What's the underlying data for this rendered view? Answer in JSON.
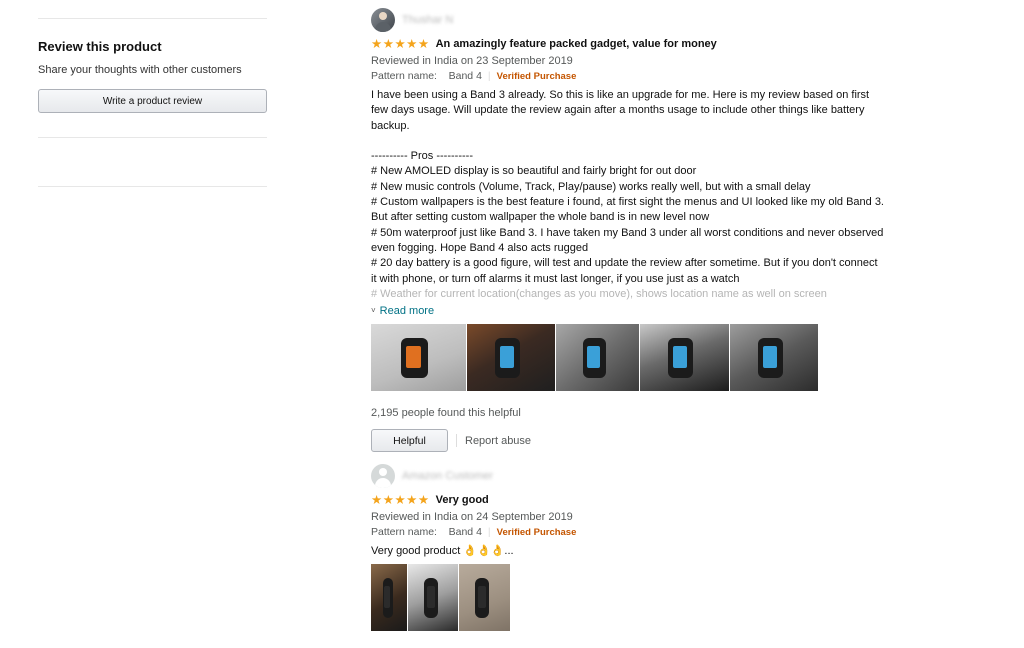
{
  "sidebar": {
    "heading": "Review this product",
    "subtitle": "Share your thoughts with other customers",
    "write_review_label": "Write a product review"
  },
  "reviews": [
    {
      "reviewer_name": "Thushar N",
      "rating": 5,
      "star_glyph": "★",
      "title": "An amazingly feature packed gadget, value for money",
      "date_line": "Reviewed in India on 23 September 2019",
      "pattern_label": "Pattern name:",
      "pattern_value": "Band 4",
      "verified": "Verified Purchase",
      "body_lines": [
        "I have been using a     Band 3 already. So this is like an upgrade for me. Here is my review based on first",
        "few days usage. Will update the review again after a months usage to include other things like battery",
        "backup.",
        "",
        "---------- Pros ----------",
        "# New AMOLED display is so beautiful and fairly bright for out door",
        "# New music controls (Volume, Track, Play/pause) works really well, but with a small delay",
        "# Custom wallpapers is the best feature i found, at first sight the menus and UI looked like my old Band 3.",
        "But after setting custom wallpaper the whole band is in new level now",
        "# 50m waterproof just like Band 3. I have taken my Band 3 under all worst conditions and never observed",
        "even fogging. Hope Band 4 also acts rugged",
        "# 20 day battery is a good figure, will test and update the review after sometime. But if you don't connect",
        "it with phone, or turn off alarms it must last longer, if you use just as a watch",
        "# Weather for current location(changes as you move), shows location name as well on screen"
      ],
      "read_more": "Read more",
      "images": [
        {
          "name": "review-image-band-charger",
          "bg": "linear-gradient(160deg,#d9d9d9 0%,#bdbdbd 60%,#9e9e9e 100%)"
        },
        {
          "name": "review-image-band-on-wrist",
          "bg": "linear-gradient(150deg,#7a4a2a 0%,#3b2a22 45%,#1f1f1f 100%)"
        },
        {
          "name": "review-image-band-in-hand",
          "bg": "linear-gradient(140deg,#a7a7a7 0%,#6d6d6d 50%,#3a3a3a 100%)"
        },
        {
          "name": "review-image-band-keyboard",
          "bg": "linear-gradient(160deg,#c8c8c8 0%,#6a6a6a 45%,#1c1c1c 100%)"
        },
        {
          "name": "review-image-band-colorful",
          "bg": "linear-gradient(150deg,#9d9d9d 0%,#5a5a5a 50%,#2c2c2c 100%)"
        }
      ],
      "helpful_count": "2,195 people found this helpful",
      "helpful_label": "Helpful",
      "report_label": "Report abuse"
    },
    {
      "reviewer_name": "Amazon Customer",
      "rating": 5,
      "star_glyph": "★",
      "title": "Very good",
      "date_line": "Reviewed in India on 24 September 2019",
      "pattern_label": "Pattern name:",
      "pattern_value": "Band 4",
      "verified": "Verified Purchase",
      "body_lines": [
        "Very good product 👌👌👌..."
      ],
      "images": [
        {
          "name": "review-image-unboxing",
          "bg": "linear-gradient(150deg,#8a6a4a 0%,#3a2a1e 55%,#1a1a1a 100%)"
        },
        {
          "name": "review-image-band-box",
          "bg": "linear-gradient(160deg,#e8e8e8 0%,#9e9e9e 50%,#2a2a2a 100%)"
        },
        {
          "name": "review-image-band-flat",
          "bg": "linear-gradient(160deg,#b8ab9c 0%,#9c8f80 60%,#7f7366 100%)"
        }
      ]
    }
  ],
  "colors": {
    "star": "#f4a41c",
    "verified": "#c45500",
    "link": "#007185",
    "muted": "#565959"
  }
}
